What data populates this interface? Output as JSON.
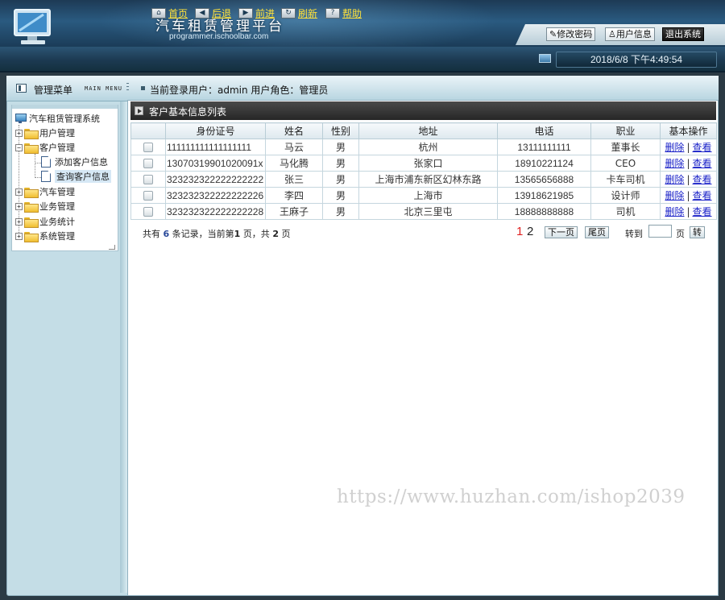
{
  "header": {
    "title": "汽车租赁管理平台",
    "subtitle": "programmer.ischoolbar.com",
    "buttons": {
      "change_password": "修改密码",
      "user_info": "用户信息",
      "logout": "退出系统"
    }
  },
  "toolbar": {
    "home": "首页",
    "back": "后退",
    "forward": "前进",
    "refresh": "刷新",
    "help": "帮助",
    "datetime": "2018/6/8 下午4:49:54"
  },
  "menu_header": {
    "title": "管理菜单",
    "subtitle": "MAIN MENU"
  },
  "login_info": "当前登录用户：admin  用户角色：管理员",
  "sidebar": {
    "root": "汽车租赁管理系统",
    "items": [
      {
        "label": "用户管理",
        "expanded": false
      },
      {
        "label": "客户管理",
        "expanded": true,
        "children": [
          "添加客户信息",
          "查询客户信息"
        ]
      },
      {
        "label": "汽车管理",
        "expanded": false
      },
      {
        "label": "业务管理",
        "expanded": false
      },
      {
        "label": "业务统计",
        "expanded": false
      },
      {
        "label": "系统管理",
        "expanded": false
      }
    ],
    "selected": "查询客户信息"
  },
  "panel": {
    "title": "客户基本信息列表",
    "columns": [
      "",
      "身份证号",
      "姓名",
      "性别",
      "地址",
      "电话",
      "职业",
      "基本操作"
    ],
    "rows": [
      {
        "id": "111111111111111111",
        "name": "马云",
        "sex": "男",
        "address": "杭州",
        "phone": "13111111111",
        "job": "董事长"
      },
      {
        "id": "13070319901020091x",
        "name": "马化腾",
        "sex": "男",
        "address": "张家口",
        "phone": "18910221124",
        "job": "CEO"
      },
      {
        "id": "323232322222222222",
        "name": "张三",
        "sex": "男",
        "address": "上海市浦东新区幻林东路",
        "phone": "13565656888",
        "job": "卡车司机"
      },
      {
        "id": "323232322222222226",
        "name": "李四",
        "sex": "男",
        "address": "上海市",
        "phone": "13918621985",
        "job": "设计师"
      },
      {
        "id": "323232322222222228",
        "name": "王麻子",
        "sex": "男",
        "address": "北京三里屯",
        "phone": "18888888888",
        "job": "司机"
      }
    ],
    "ops": {
      "delete": "删除",
      "sep": "|",
      "view": "查看"
    }
  },
  "pager": {
    "prefix": "共有",
    "total": "6",
    "middle": "条记录，当前第",
    "current": "1",
    "middle2": "页，共",
    "pages": "2",
    "suffix": "页",
    "page1": "1",
    "page2": "2",
    "next": "下一页",
    "last": "尾页",
    "jump_to": "转到",
    "page_unit": "页",
    "go": "转"
  },
  "watermark": "https://www.huzhan.com/ishop2039"
}
